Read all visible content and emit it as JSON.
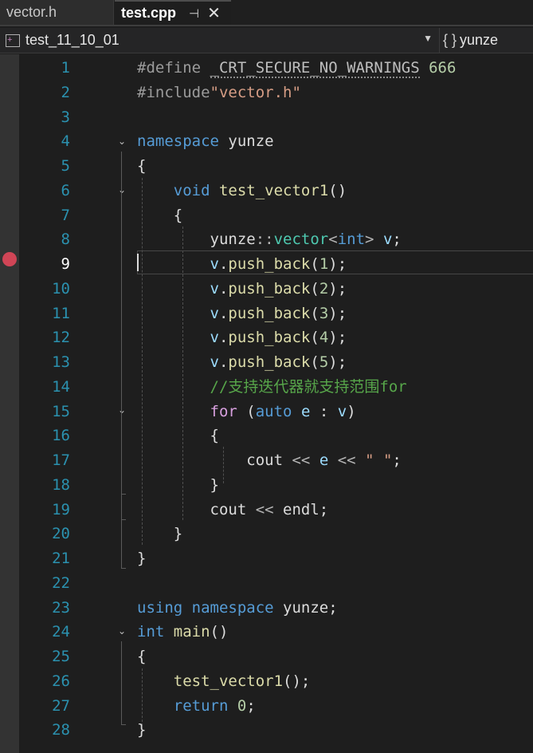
{
  "tabs": [
    {
      "label": "vector.h",
      "active": false
    },
    {
      "label": "test.cpp",
      "active": true
    }
  ],
  "tab_icons": {
    "pin": "⊣",
    "close": "✕"
  },
  "nav": {
    "scope": "test_11_10_01",
    "member_braces": "{ }",
    "member": "yunze"
  },
  "editor": {
    "current_line": 9,
    "breakpoint_line": 9,
    "line_numbers": [
      "1",
      "2",
      "3",
      "4",
      "5",
      "6",
      "7",
      "8",
      "9",
      "10",
      "11",
      "12",
      "13",
      "14",
      "15",
      "16",
      "17",
      "18",
      "19",
      "20",
      "21",
      "22",
      "23",
      "24",
      "25",
      "26",
      "27",
      "28"
    ],
    "lines": [
      "#define _CRT_SECURE_NO_WARNINGS 666",
      "#include\"vector.h\"",
      "",
      "namespace yunze",
      "{",
      "    void test_vector1()",
      "    {",
      "        yunze::vector<int> v;",
      "        v.push_back(1);",
      "        v.push_back(2);",
      "        v.push_back(3);",
      "        v.push_back(4);",
      "        v.push_back(5);",
      "        //支持迭代器就支持范围for",
      "        for (auto e : v)",
      "        {",
      "            cout << e << \" \";",
      "        }",
      "        cout << endl;",
      "    }",
      "}",
      "",
      "using namespace yunze;",
      "int main()",
      "{",
      "    test_vector1();",
      "    return 0;",
      "}"
    ]
  },
  "colors": {
    "keyword": "#569cd6",
    "control": "#d8a0df",
    "function": "#dcdcaa",
    "type": "#4ec9b0",
    "comment": "#57a64a",
    "string": "#d69d85",
    "number": "#b5cea8",
    "variable": "#9cdcfe",
    "line_number": "#2b91af",
    "breakpoint": "#d04556"
  }
}
